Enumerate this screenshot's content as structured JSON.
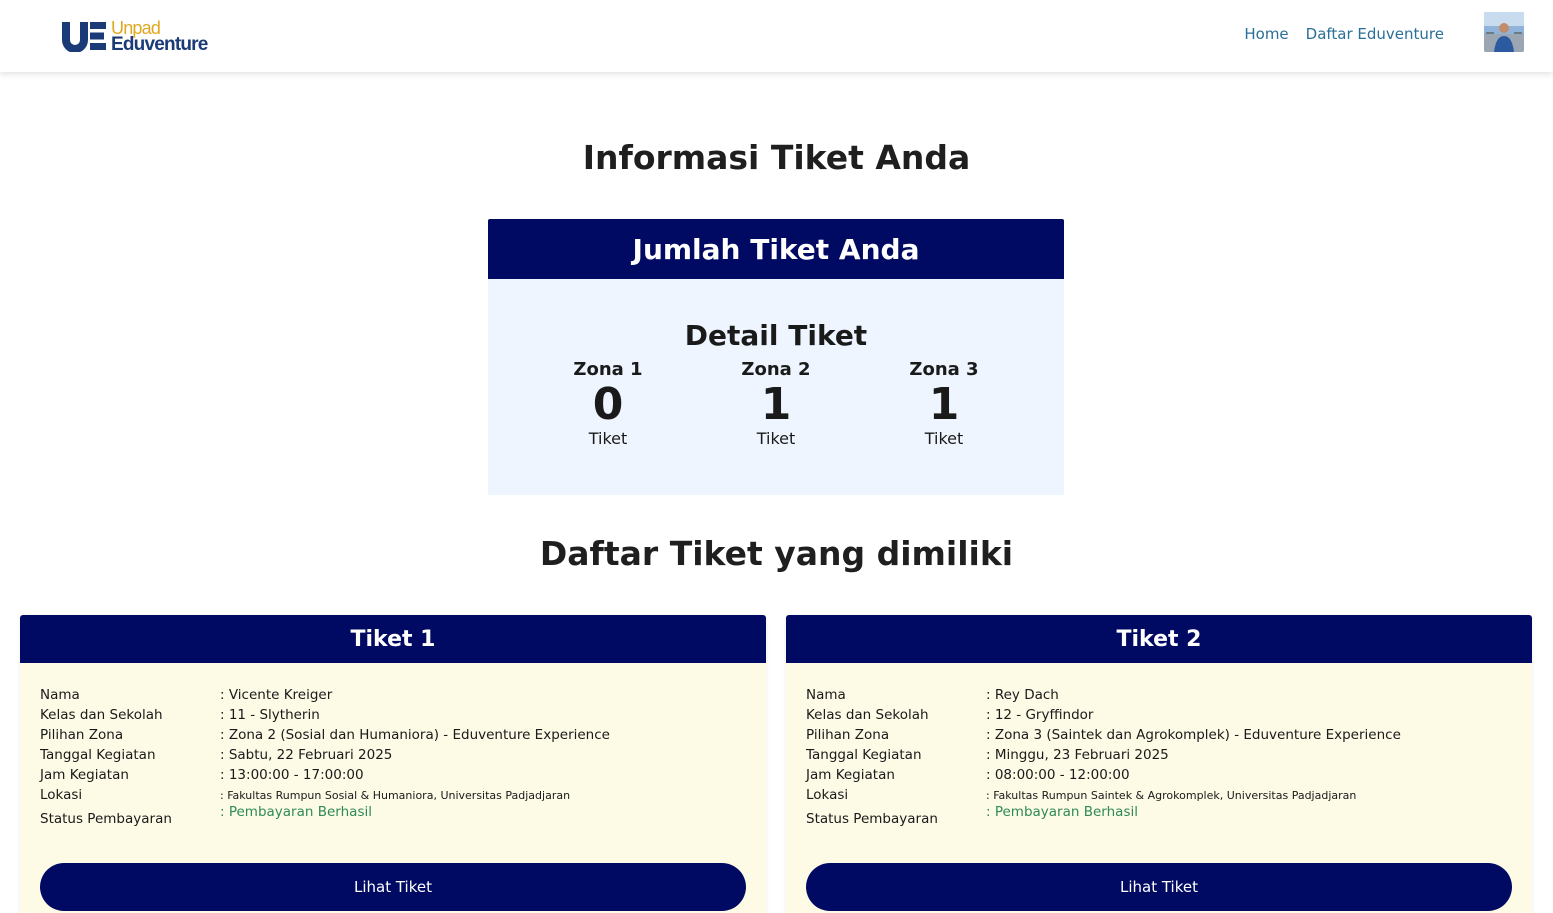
{
  "navbar": {
    "logo_line1": "Unpad",
    "logo_line2": "Eduventure",
    "links": [
      "Home",
      "Daftar Eduventure"
    ]
  },
  "page_title": "Informasi Tiket Anda",
  "summary": {
    "header": "Jumlah Tiket Anda",
    "subtitle": "Detail Tiket",
    "zones": [
      {
        "name": "Zona 1",
        "count": "0",
        "unit": "Tiket"
      },
      {
        "name": "Zona 2",
        "count": "1",
        "unit": "Tiket"
      },
      {
        "name": "Zona 3",
        "count": "1",
        "unit": "Tiket"
      }
    ]
  },
  "list_title": "Daftar Tiket yang dimiliki",
  "labels": {
    "nama": "Nama",
    "kelas": "Kelas dan Sekolah",
    "zona": "Pilihan Zona",
    "tanggal": "Tanggal Kegiatan",
    "jam": "Jam Kegiatan",
    "lokasi": "Lokasi",
    "status": "Status Pembayaran"
  },
  "tickets": [
    {
      "title": "Tiket 1",
      "nama": ": Vicente Kreiger",
      "kelas": ": 11 - Slytherin",
      "zona": ": Zona 2 (Sosial dan Humaniora) - Eduventure Experience",
      "tanggal": ": Sabtu, 22 Februari 2025",
      "jam": ": 13:00:00 - 17:00:00",
      "lokasi": ": Fakultas Rumpun Sosial & Humaniora, Universitas Padjadjaran",
      "status": ": Pembayaran Berhasil",
      "button": "Lihat Tiket"
    },
    {
      "title": "Tiket 2",
      "nama": ": Rey Dach",
      "kelas": ": 12 - Gryffindor",
      "zona": ": Zona 3 (Saintek dan Agrokomplek) - Eduventure Experience",
      "tanggal": ": Minggu, 23 Februari 2025",
      "jam": ": 08:00:00 - 12:00:00",
      "lokasi": ": Fakultas Rumpun Saintek & Agrokomplek, Universitas Padjadjaran",
      "status": ": Pembayaran Berhasil",
      "button": "Lihat Tiket"
    }
  ],
  "colors": {
    "primary": "#000a63",
    "summary_bg": "#eef5ff",
    "ticket_bg": "#fdfae6",
    "link": "#2a6f97",
    "status_ok": "#2e8b57",
    "logo_gold": "#e0a820",
    "logo_blue": "#1b3a78"
  }
}
